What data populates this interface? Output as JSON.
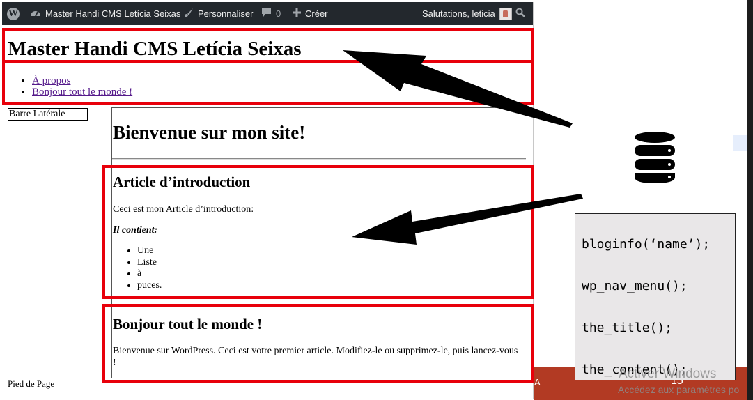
{
  "admin_bar": {
    "site_name": "Master Handi CMS Letícia Seixas",
    "customize_label": "Personnaliser",
    "comments_count": "0",
    "new_label": "Créer",
    "greeting": "Salutations, leticia"
  },
  "site": {
    "title": "Master Handi CMS Letícia Seixas",
    "menu": [
      "À propos",
      "Bonjour tout le monde !"
    ]
  },
  "sidebar": {
    "label": "Barre Latérale"
  },
  "page": {
    "title": "Bienvenue sur mon site!",
    "articles": [
      {
        "title": "Article d’introduction",
        "intro": "Ceci est mon Article d’introduction:",
        "contains_label": "Il contient:",
        "bullets": [
          "Une",
          "Liste",
          "à",
          "puces."
        ]
      },
      {
        "title": "Bonjour tout le monde !",
        "body": "Bienvenue sur WordPress. Ceci est votre premier article. Modifiez-le ou supprimez-le, puis lancez-vous !"
      }
    ]
  },
  "footer": {
    "label": "Pied de Page"
  },
  "code_panel": {
    "lines": [
      "bloginfo(‘name’);",
      "wp_nav_menu();",
      "the_title();",
      "the_content();"
    ]
  },
  "slide": {
    "page_number": "15",
    "left_text": "A"
  },
  "watermark": {
    "title": "Activer Windows",
    "subtitle": "Accédez aux paramètres po"
  },
  "colors": {
    "admin_bar_bg": "#23282d",
    "highlight_red": "#e8000b",
    "slide_bar": "#b23a23",
    "code_panel_bg": "#e9e7e8",
    "link": "#551a8b"
  },
  "icons": [
    "wordpress-logo-icon",
    "dashboard-icon",
    "brush-icon",
    "comment-icon",
    "plus-icon",
    "search-icon",
    "database-icon"
  ]
}
